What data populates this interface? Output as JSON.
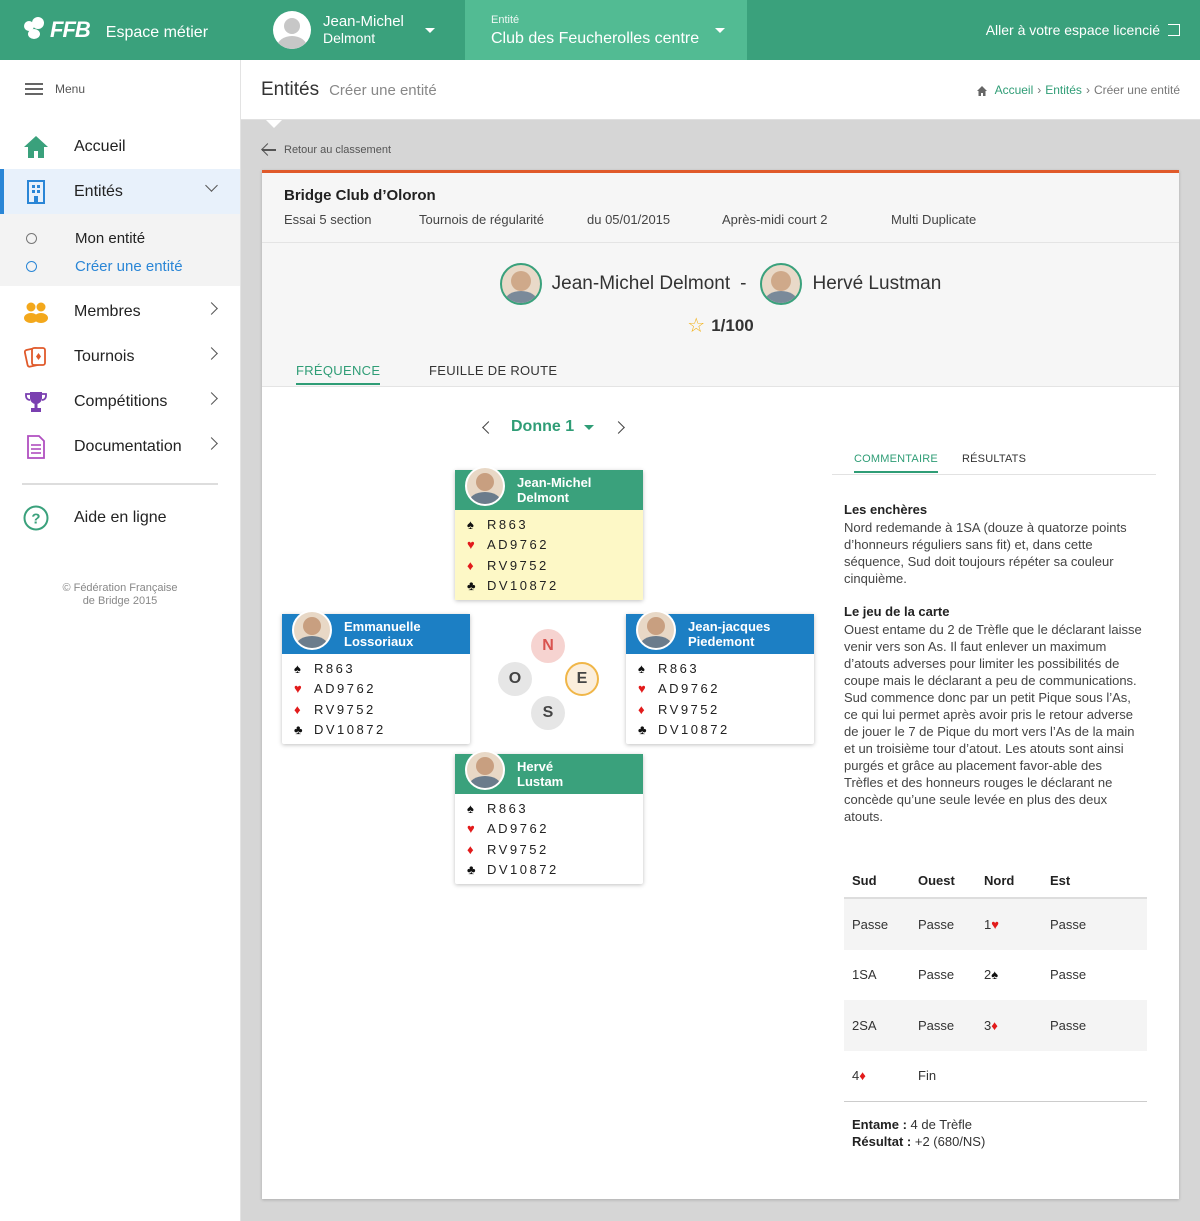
{
  "topbar": {
    "logo_text": "FFB",
    "app_title": "Espace métier",
    "user_first": "Jean-Michel",
    "user_last": "Delmont",
    "entity_label": "Entité",
    "entity_name": "Club des Feucherolles centre",
    "licence_link": "Aller à votre espace licencié"
  },
  "sidebar": {
    "menu_label": "Menu",
    "items": [
      {
        "label": "Accueil",
        "icon": "home-icon"
      },
      {
        "label": "Entités",
        "icon": "building-icon"
      },
      {
        "label": "Membres",
        "icon": "people-icon"
      },
      {
        "label": "Tournois",
        "icon": "cards-icon"
      },
      {
        "label": "Compétitions",
        "icon": "trophy-icon"
      },
      {
        "label": "Documentation",
        "icon": "document-icon"
      },
      {
        "label": "Aide en ligne",
        "icon": "help-icon"
      }
    ],
    "sub_items": [
      "Mon entité",
      "Créer une entité"
    ],
    "copyright_1": "© Fédération Française",
    "copyright_2": "de Bridge 2015"
  },
  "header": {
    "title": "Entités",
    "subtitle": "Créer une entité",
    "breadcrumb": [
      "Accueil",
      "Entités",
      "Créer une entité"
    ]
  },
  "back_link": "Retour au classement",
  "card": {
    "club": "Bridge Club d’Oloron",
    "meta": [
      "Essai 5 section",
      "Tournois de régularité",
      "du 05/01/2015",
      "Après-midi court 2",
      "Multi Duplicate"
    ],
    "player1": "Jean-Michel Delmont",
    "separator": "-",
    "player2": "Hervé Lustman",
    "rank": "1/100",
    "tabs": [
      "FRÉQUENCE",
      "FEUILLE DE ROUTE"
    ]
  },
  "deal": {
    "label": "Donne 1",
    "hands": {
      "north": {
        "name1": "Jean-Michel",
        "name2": "Delmont",
        "spades": "R863",
        "hearts": "AD9762",
        "diamonds": "RV9752",
        "clubs": "DV10872"
      },
      "west": {
        "name1": "Emmanuelle",
        "name2": "Lossoriaux",
        "spades": "R863",
        "hearts": "AD9762",
        "diamonds": "RV9752",
        "clubs": "DV10872"
      },
      "east": {
        "name1": "Jean-jacques",
        "name2": "Piedemont",
        "spades": "R863",
        "hearts": "AD9762",
        "diamonds": "RV9752",
        "clubs": "DV10872"
      },
      "south": {
        "name1": "Hervé",
        "name2": "Lustam",
        "spades": "R863",
        "hearts": "AD9762",
        "diamonds": "RV9752",
        "clubs": "DV10872"
      }
    },
    "compass": {
      "n": "N",
      "o": "O",
      "e": "E",
      "s": "S"
    }
  },
  "panel": {
    "tabs": [
      "COMMENTAIRE",
      "RÉSULTATS"
    ],
    "h1": "Les enchères",
    "p1": "Nord redemande à 1SA (douze à quatorze points d’honneurs réguliers sans fit) et, dans cette séquence, Sud doit toujours répéter sa couleur cinquième.",
    "h2": "Le jeu de la carte",
    "p2": "Ouest entame du 2 de Trèfle que le déclarant laisse venir vers son As. Il faut enlever un maximum d’atouts adverses pour limiter les possibilités de coupe mais le déclarant a peu de communications. Sud commence donc par un petit Pique sous l’As, ce qui lui permet après avoir pris le retour adverse de jouer le 7 de Pique du mort vers l’As de la main et un troisième tour d’atout. Les atouts sont ainsi purgés et grâce au placement favor-able des Trèfles et des honneurs rouges le déclarant ne concède qu’une seule levée en plus des deux atouts.",
    "bid_headers": [
      "Sud",
      "Ouest",
      "Nord",
      "Est"
    ],
    "bid_rows": [
      [
        "Passe",
        "Passe",
        "1",
        "Passe"
      ],
      [
        "1SA",
        "Passe",
        "2",
        "Passe"
      ],
      [
        "2SA",
        "Passe",
        "3",
        "Passe"
      ],
      [
        "4",
        "Fin",
        "",
        ""
      ]
    ],
    "entame_label": "Entame :",
    "entame_value": "4 de Trèfle",
    "result_label": "Résultat :",
    "result_value": "+2 (680/NS)"
  },
  "colors": {
    "brand_green": "#3aa17c",
    "accent_blue": "#1c7fc4",
    "card_top": "#e05a2b"
  }
}
